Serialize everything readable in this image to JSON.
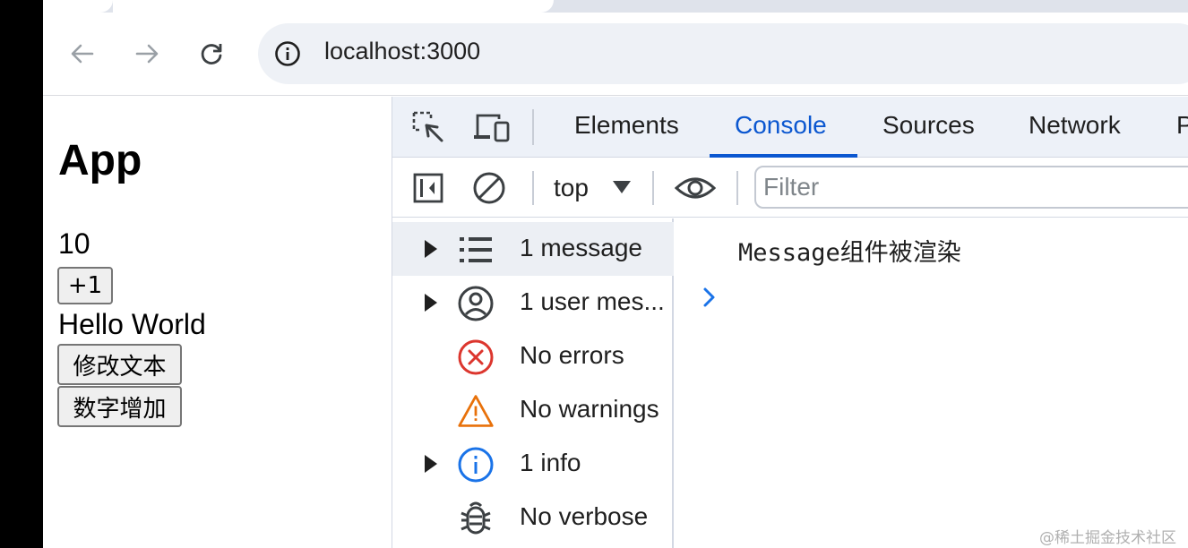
{
  "browser": {
    "url": "localhost:3000"
  },
  "page": {
    "title": "App",
    "count": "10",
    "increment_label": "+1",
    "text": "Hello World",
    "change_text_label": "修改文本",
    "add_number_label": "数字增加"
  },
  "devtools": {
    "tabs": [
      "Elements",
      "Console",
      "Sources",
      "Network"
    ],
    "active_tab": "Console",
    "context": "top",
    "filter_placeholder": "Filter",
    "sidebar": [
      {
        "label": "1 message",
        "icon": "list-icon"
      },
      {
        "label": "1 user mes...",
        "icon": "user-icon"
      },
      {
        "label": "No errors",
        "icon": "error-icon"
      },
      {
        "label": "No warnings",
        "icon": "warning-icon"
      },
      {
        "label": "1 info",
        "icon": "info-icon"
      },
      {
        "label": "No verbose",
        "icon": "bug-icon"
      }
    ],
    "console_message": "Message组件被渲染",
    "accent_color": "#0b57d0"
  },
  "watermark": "@稀土掘金技术社区"
}
